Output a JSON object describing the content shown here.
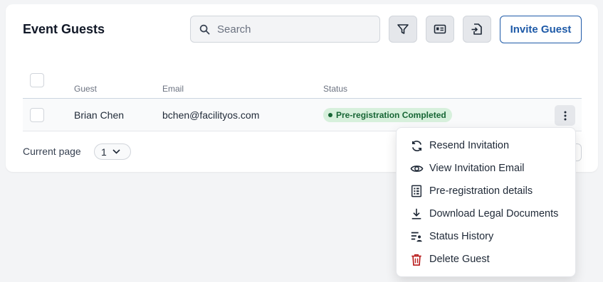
{
  "header": {
    "title": "Event Guests"
  },
  "search": {
    "placeholder": "Search",
    "value": ""
  },
  "toolbar": {
    "invite_label": "Invite Guest"
  },
  "table": {
    "columns": [
      "Guest",
      "Email",
      "Status"
    ],
    "rows": [
      {
        "guest": "Brian Chen",
        "email": "bchen@facilityos.com",
        "status": "Pre-registration Completed"
      }
    ]
  },
  "pagination": {
    "label": "Current page",
    "current": "1"
  },
  "menu": {
    "items": [
      {
        "label": "Resend Invitation",
        "icon": "refresh-icon"
      },
      {
        "label": "View Invitation Email",
        "icon": "eye-icon"
      },
      {
        "label": "Pre-registration details",
        "icon": "form-icon"
      },
      {
        "label": "Download Legal Documents",
        "icon": "download-icon"
      },
      {
        "label": "Status History",
        "icon": "history-icon"
      },
      {
        "label": "Delete Guest",
        "icon": "trash-icon"
      }
    ]
  },
  "colors": {
    "accent": "#1e5aa8",
    "status_bg": "#d7f0dc",
    "status_text": "#166534",
    "danger": "#b91c1c"
  }
}
